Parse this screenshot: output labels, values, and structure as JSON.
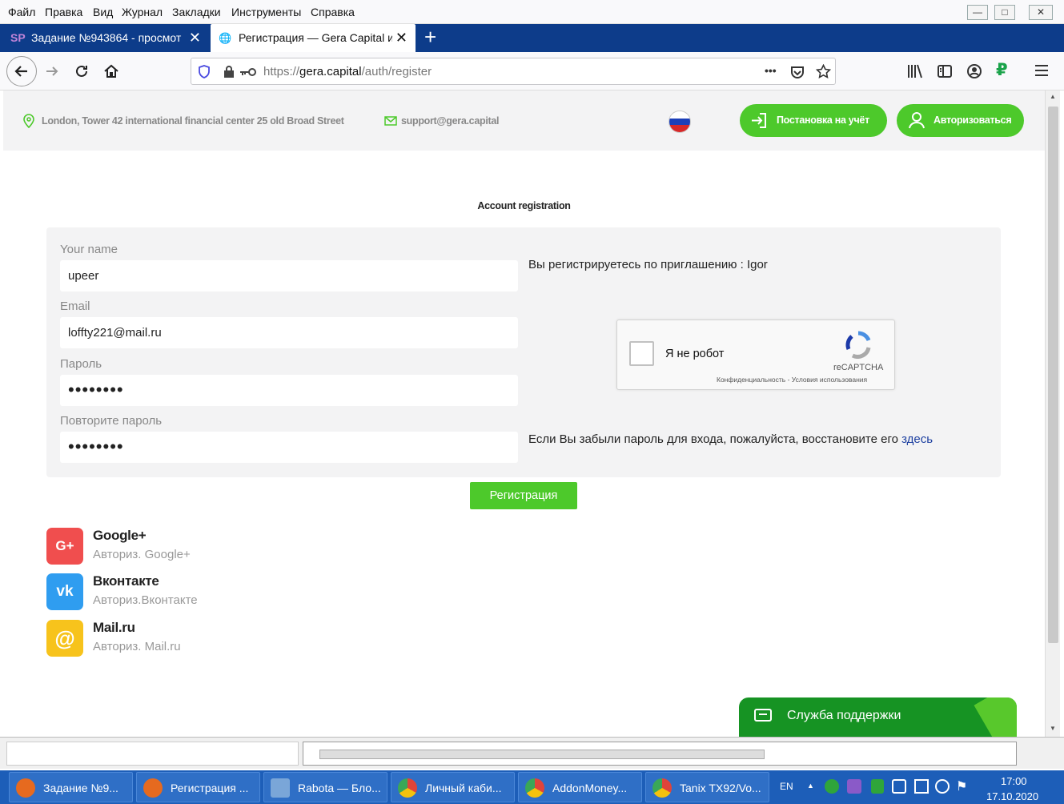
{
  "menubar": {
    "items": [
      "Файл",
      "Правка",
      "Вид",
      "Журнал",
      "Закладки",
      "Инструменты",
      "Справка"
    ],
    "minimize": "—",
    "maximize": "□",
    "close": "✕"
  },
  "tabs": [
    {
      "favicon": "SP",
      "label": "Задание №943864 - просмот",
      "close": "✕"
    },
    {
      "favicon": "🌐",
      "label": "Регистрация — Gera Capital ин",
      "close": "✕"
    }
  ],
  "new_tab": "+",
  "nav": {
    "url_prefix": "https://",
    "url_host": "gera.capital",
    "url_path": "/auth/register",
    "more": "•••",
    "ruble": "₽"
  },
  "header": {
    "address": "London, Tower 42 international financial center 25 old Broad Street",
    "email": "support@gera.capital",
    "register_btn": "Постановка на учёт",
    "login_btn": "Авторизоваться"
  },
  "form": {
    "title": "Account registration",
    "name_label": "Your name",
    "name_value": "upeer",
    "email_label": "Email",
    "email_value": "loffty221@mail.ru",
    "password_label": "Пароль",
    "password_value": "••••••••",
    "repeat_label": "Повторите пароль",
    "repeat_value": "••••••••",
    "invite_text": "Вы регистрируетесь по приглашению : Igor",
    "forgot_text": "Если Вы забыли пароль для входа, пожалуйста, восстановите его",
    "forgot_link": "здесь",
    "submit": "Регистрация"
  },
  "captcha": {
    "label": "Я не робот",
    "brand": "reCAPTCHA",
    "links": "Конфиденциальность - Условия использования"
  },
  "social": [
    {
      "icon": "G+",
      "title": "Google+",
      "subtitle": "Авториз. Google+",
      "color": "#f04e4e"
    },
    {
      "icon": "vk",
      "title": "Вконтакте",
      "subtitle": "Авториз.Вконтакте",
      "color": "#2f9df0"
    },
    {
      "icon": "@",
      "title": "Mail.ru",
      "subtitle": "Авториз. Mail.ru",
      "color": "#f7c31c"
    }
  ],
  "support": {
    "label": "Служба поддержки"
  },
  "taskbar": {
    "tasks": [
      {
        "label": "Задание №9...",
        "color": "#e66a1f"
      },
      {
        "label": "Регистрация ...",
        "color": "#e66a1f"
      },
      {
        "label": "Rabota — Бло...",
        "color": "#7aa6d8"
      },
      {
        "label": "Личный каби...",
        "color": "#e0c020"
      },
      {
        "label": "AddonMoney...",
        "color": "#e0c020"
      },
      {
        "label": "Tanix TX92/Vo...",
        "color": "#e0c020"
      }
    ],
    "lang": "EN",
    "time": "17:00",
    "date": "17.10.2020"
  }
}
